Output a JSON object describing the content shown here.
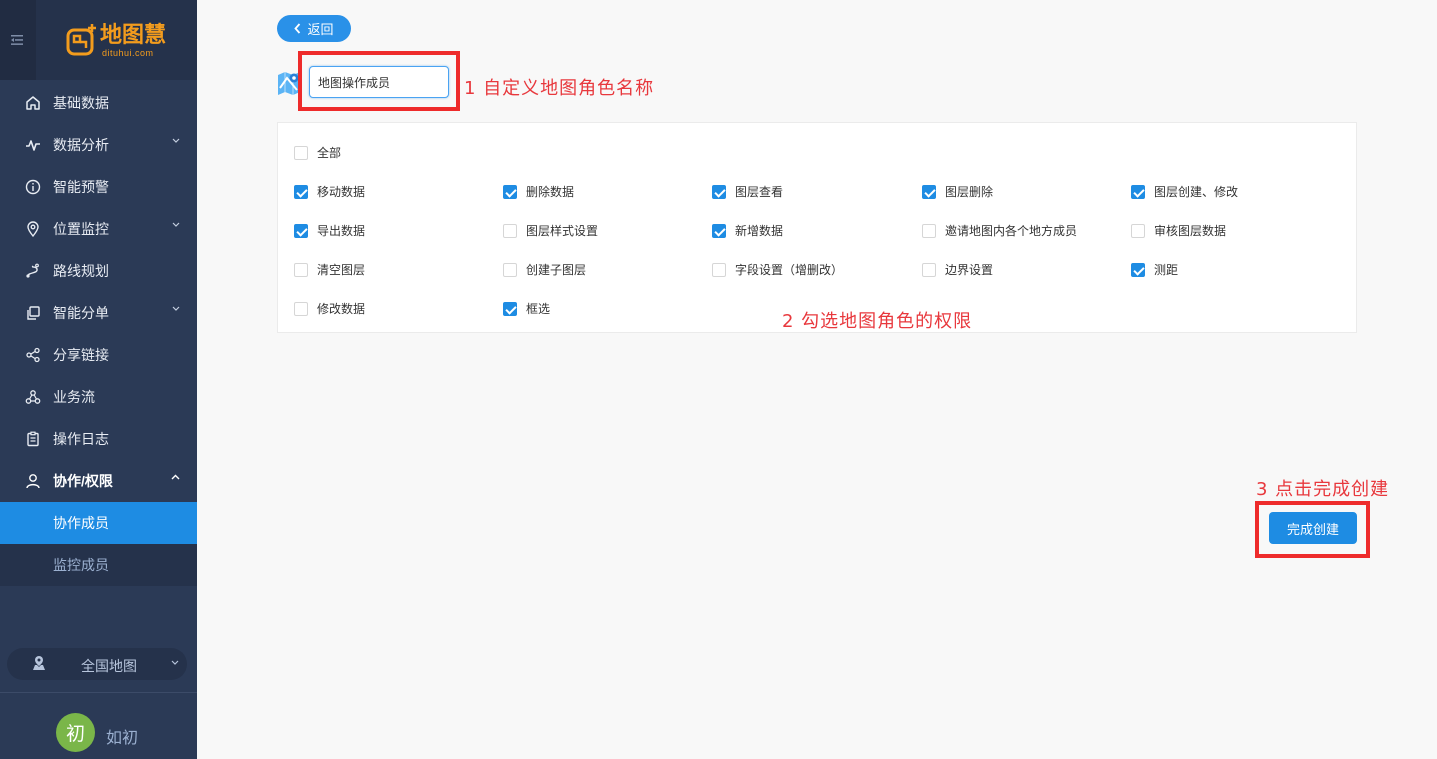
{
  "app": {
    "logo_title": "地图慧",
    "logo_sub": "dituhui.com"
  },
  "sidebar": {
    "items": [
      {
        "label": "基础数据",
        "icon": "home-icon"
      },
      {
        "label": "数据分析",
        "icon": "analytics-icon",
        "chevron": "down"
      },
      {
        "label": "智能预警",
        "icon": "info-icon"
      },
      {
        "label": "位置监控",
        "icon": "location-pin-icon",
        "chevron": "down"
      },
      {
        "label": "路线规划",
        "icon": "route-icon"
      },
      {
        "label": "智能分单",
        "icon": "copy-icon",
        "chevron": "down"
      },
      {
        "label": "分享链接",
        "icon": "share-icon"
      },
      {
        "label": "业务流",
        "icon": "workflow-icon"
      },
      {
        "label": "操作日志",
        "icon": "clipboard-icon"
      },
      {
        "label": "协作/权限",
        "icon": "user-icon",
        "chevron": "up"
      }
    ],
    "subitems": [
      {
        "label": "协作成员",
        "active": true
      },
      {
        "label": "监控成员",
        "active": false
      }
    ],
    "region_label": "全国地图",
    "user": {
      "avatar_char": "初",
      "name": "如初"
    }
  },
  "main": {
    "back_label": "返回",
    "role_name_value": "地图操作成员",
    "annotation_1": "1  自定义地图角色名称",
    "annotation_2": "2 勾选地图角色的权限",
    "annotation_3": "3 点击完成创建",
    "finish_label": "完成创建",
    "permissions": {
      "all": {
        "label": "全部",
        "checked": false
      },
      "rows": [
        [
          {
            "label": "移动数据",
            "checked": true
          },
          {
            "label": "删除数据",
            "checked": true
          },
          {
            "label": "图层查看",
            "checked": true
          },
          {
            "label": "图层删除",
            "checked": true
          },
          {
            "label": "图层创建、修改",
            "checked": true
          }
        ],
        [
          {
            "label": "导出数据",
            "checked": true
          },
          {
            "label": "图层样式设置",
            "checked": false
          },
          {
            "label": "新增数据",
            "checked": true
          },
          {
            "label": "邀请地图内各个地方成员",
            "checked": false
          },
          {
            "label": "审核图层数据",
            "checked": false
          }
        ],
        [
          {
            "label": "清空图层",
            "checked": false
          },
          {
            "label": "创建子图层",
            "checked": false
          },
          {
            "label": "字段设置（增删改）",
            "checked": false
          },
          {
            "label": "边界设置",
            "checked": false
          },
          {
            "label": "测距",
            "checked": true
          }
        ],
        [
          {
            "label": "修改数据",
            "checked": false
          },
          {
            "label": "框选",
            "checked": true
          }
        ]
      ]
    }
  },
  "colors": {
    "sidebar_bg": "#2b3a56",
    "accent": "#1e8ce3",
    "logo": "#f39c1d",
    "annotation": "#ee2b2b"
  }
}
